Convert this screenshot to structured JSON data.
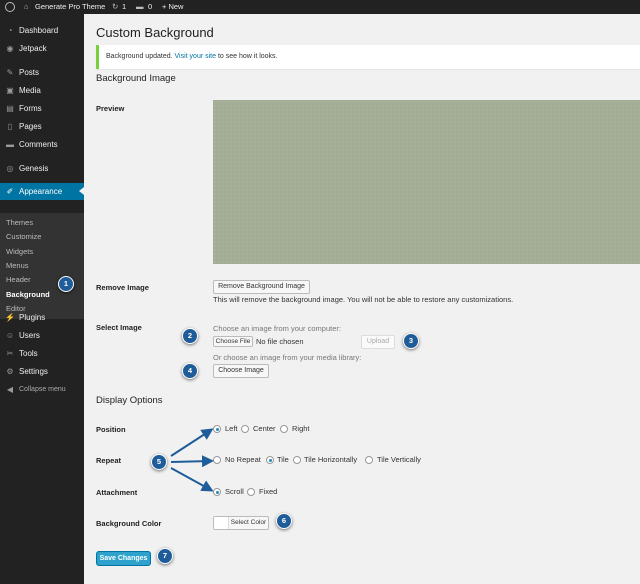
{
  "adminbar": {
    "site_name": "Generate Pro Theme",
    "updates_count": "1",
    "comments_count": "0",
    "new_label": "+ New"
  },
  "sidebar": {
    "items": [
      {
        "label": "Dashboard",
        "icon": "dashboard-icon",
        "glyph": "◔"
      },
      {
        "label": "Jetpack",
        "icon": "jetpack-icon",
        "glyph": "◉"
      },
      {
        "label": "Posts",
        "icon": "pin-icon",
        "glyph": "✎"
      },
      {
        "label": "Media",
        "icon": "media-icon",
        "glyph": "▣"
      },
      {
        "label": "Forms",
        "icon": "forms-icon",
        "glyph": "▤"
      },
      {
        "label": "Pages",
        "icon": "pages-icon",
        "glyph": "▯"
      },
      {
        "label": "Comments",
        "icon": "comments-icon",
        "glyph": "▬"
      },
      {
        "label": "Genesis",
        "icon": "genesis-icon",
        "glyph": "◎"
      },
      {
        "label": "Appearance",
        "icon": "brush-icon",
        "glyph": "✐"
      },
      {
        "label": "Plugins",
        "icon": "plugins-icon",
        "glyph": "⚡"
      },
      {
        "label": "Users",
        "icon": "users-icon",
        "glyph": "☺"
      },
      {
        "label": "Tools",
        "icon": "tools-icon",
        "glyph": "✂"
      },
      {
        "label": "Settings",
        "icon": "settings-icon",
        "glyph": "⚙"
      }
    ],
    "submenu": [
      "Themes",
      "Customize",
      "Widgets",
      "Menus",
      "Header",
      "Background",
      "Editor"
    ],
    "collapse_label": "Collapse menu"
  },
  "page": {
    "title": "Custom Background",
    "notice_text": "Background updated.",
    "notice_link": "Visit your site",
    "notice_suffix": "to see how it looks.",
    "bg_image_heading": "Background Image",
    "preview_label": "Preview",
    "remove_label": "Remove Image",
    "remove_button": "Remove Background Image",
    "remove_help": "This will remove the background image. You will not be able to restore any customizations.",
    "select_label": "Select Image",
    "choose_computer": "Choose an image from your computer:",
    "choose_file_button": "Choose File",
    "no_file": "No file chosen",
    "upload_button": "Upload",
    "or_library": "Or choose an image from your media library:",
    "choose_image_button": "Choose Image",
    "display_heading": "Display Options",
    "position_label": "Position",
    "position_options": [
      "Left",
      "Center",
      "Right"
    ],
    "repeat_label": "Repeat",
    "repeat_options": [
      "No Repeat",
      "Tile",
      "Tile Horizontally",
      "Tile Vertically"
    ],
    "attachment_label": "Attachment",
    "attachment_options": [
      "Scroll",
      "Fixed"
    ],
    "bgcolor_label": "Background Color",
    "select_color_button": "Select Color",
    "save_button": "Save Changes"
  },
  "callouts": [
    "1",
    "2",
    "3",
    "4",
    "5",
    "6",
    "7"
  ],
  "colors": {
    "sidebar": "#222222",
    "active": "#0074a2",
    "preview": "#a3ad96",
    "primary": "#2ea2cc",
    "callout": "#1f5c9a",
    "notice_border": "#7ad03a"
  }
}
